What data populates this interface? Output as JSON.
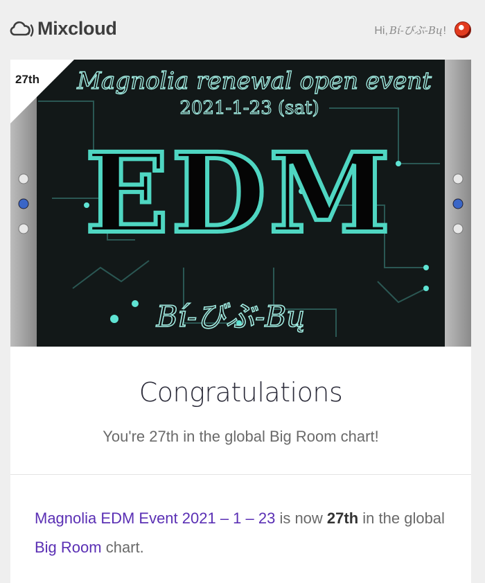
{
  "header": {
    "logo_text": "Mixcloud",
    "greeting_prefix": "Hi, ",
    "username": "Bí-びぶ-Bų",
    "greeting_suffix": "!"
  },
  "artwork": {
    "rank_badge": "27th",
    "line1": "Magnolia renewal open event",
    "line2": "2021-1-23 (sat)",
    "big_text": "EDM",
    "artist": "Bí-びぶ-Bų"
  },
  "notification": {
    "title": "Congratulations",
    "subtitle": "You're 27th in the global Big Room chart!",
    "show_name": "Magnolia EDM Event 2021 – 1 – 23",
    "text_mid": " is now ",
    "rank": "27th",
    "text_in": " in the global ",
    "chart_name": "Big Room",
    "text_end": " chart."
  },
  "colors": {
    "accent": "#5a2fb4",
    "artwork_glow": "#4fd6c2",
    "artwork_bg": "#0f1414"
  },
  "icons": {
    "logo": "mixcloud-cloud-icon",
    "avatar": "user-avatar"
  }
}
